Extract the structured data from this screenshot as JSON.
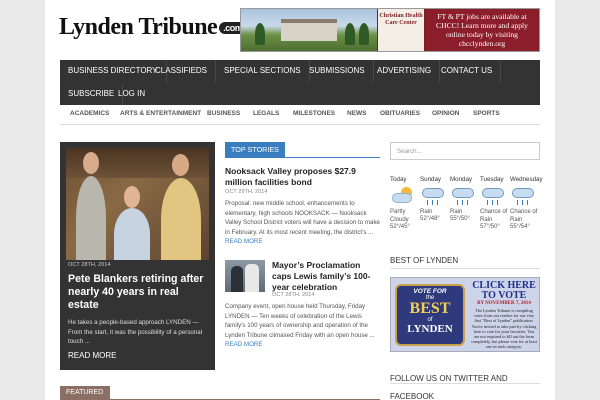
{
  "site": {
    "logo_text": "Lynden Tribune",
    "logo_suffix": ".com"
  },
  "ad_banner": {
    "org_name": "Christian Health Care Center",
    "text": "FT & PT jobs are available at CHCC! Learn more and apply online today by visiting chcclynden.org"
  },
  "nav": {
    "items": [
      {
        "label": "Business Directory"
      },
      {
        "label": "Classifieds"
      },
      {
        "label": "Special Sections"
      },
      {
        "label": "Submissions"
      },
      {
        "label": "Advertising"
      },
      {
        "label": "Contact Us"
      },
      {
        "label": "Subscribe"
      },
      {
        "label": "Log In"
      }
    ]
  },
  "subnav": {
    "items": [
      {
        "label": "Academics"
      },
      {
        "label": "Arts & Entertainment"
      },
      {
        "label": "Business"
      },
      {
        "label": "Legals"
      },
      {
        "label": "Milestones"
      },
      {
        "label": "News"
      },
      {
        "label": "Obituaries"
      },
      {
        "label": "Opinion"
      },
      {
        "label": "Sports"
      }
    ]
  },
  "featured_story": {
    "date": "OCT 28TH, 2014",
    "title": "Pete Blankers retiring after nearly 40 years in real estate",
    "excerpt": "He takes a people-based approach LYNDEN — From the start, it was the possibility of a personal touch ...",
    "read_more": "READ MORE"
  },
  "top_stories": {
    "heading": "TOP STORIES",
    "stories": [
      {
        "title": "Nooksack Valley proposes $27.9 million facilities bond",
        "date": "OCT 29TH, 2014",
        "excerpt": "Proposal: new middle school, enhancements to elementary, high schools NOOKSACK — Nooksack Valley School District voters will have a decision to make in February. At its most recent meeting, the district’s ...",
        "read_more": "READ MORE"
      },
      {
        "title": "Mayor’s Proclamation caps Lewis family’s 100-year celebration",
        "date": "OCT 28TH, 2014",
        "excerpt": "Company event, open house held Thursday, Friday LYNDEN — Ten weeks of celebration of the Lewis family’s 100 years of ownership and operation of the Lynden Tribune climaxed Friday with an open house ...",
        "read_more": "READ MORE"
      }
    ]
  },
  "search": {
    "placeholder": "Search..."
  },
  "weather": {
    "days": [
      {
        "day": "Today",
        "condition": "Partly Cloudy",
        "temps": "52°/45°",
        "icon": "partly-cloudy"
      },
      {
        "day": "Sunday",
        "condition": "Rain",
        "temps": "52°/48°",
        "icon": "rain"
      },
      {
        "day": "Monday",
        "condition": "Rain",
        "temps": "55°/50°",
        "icon": "rain"
      },
      {
        "day": "Tuesday",
        "condition": "Chance of Rain",
        "temps": "57°/50°",
        "icon": "rain"
      },
      {
        "day": "Wednesday",
        "condition": "Chance of Rain",
        "temps": "55°/54°",
        "icon": "rain"
      }
    ]
  },
  "best_of_lynden": {
    "heading": "BEST OF LYNDEN",
    "badge_vote": "VOTE FOR",
    "badge_the": "the",
    "badge_best": "BEST",
    "badge_of": "of",
    "badge_place": "LYNDEN",
    "click_text": "CLICK HERE TO VOTE",
    "by_date": "BY NOVEMBER 7, 2014",
    "small_text": "The Lynden Tribune is compiling votes from our readers for our very first \"Best of Lynden\" publication. You're invited to take part by clicking here to vote for your favorites. You are not required to fill out the form completely, but please vote for at least one in each category."
  },
  "follow": {
    "heading": "FOLLOW US ON TWITTER AND FACEBOOK"
  },
  "featured_section": {
    "label": "FEATURED"
  },
  "colors": {
    "nav_bg": "#333333",
    "accent_blue": "#3a7ebf",
    "featured_tab": "#8b6f64",
    "ad_red": "#8c1d2b"
  }
}
